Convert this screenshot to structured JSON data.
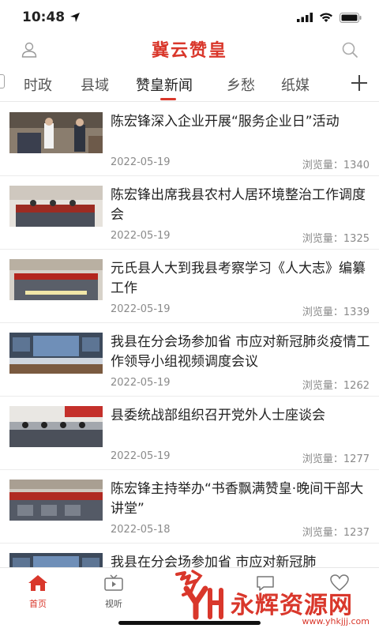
{
  "status": {
    "time": "10:48"
  },
  "header": {
    "title": "冀云赞皇"
  },
  "tabs": [
    {
      "label": "时政"
    },
    {
      "label": "县域"
    },
    {
      "label": "赞皇新闻"
    },
    {
      "label": "乡愁"
    },
    {
      "label": "纸媒"
    }
  ],
  "views_label": "浏览量：",
  "news": [
    {
      "title": "陈宏锋深入企业开展“服务企业日”活动",
      "date": "2022-05-19",
      "views": "浏览量：1340"
    },
    {
      "title": "陈宏锋出席我县农村人居环境整治工作调度会",
      "date": "2022-05-19",
      "views": "浏览量：1325"
    },
    {
      "title": "元氏县人大到我县考察学习《人大志》编纂工作",
      "date": "2022-05-19",
      "views": "浏览量：1339"
    },
    {
      "title": "我县在分会场参加省 市应对新冠肺炎疫情工作领导小组视频调度会议",
      "date": "2022-05-19",
      "views": "浏览量：1262"
    },
    {
      "title": "县委统战部组织召开党外人士座谈会",
      "date": "2022-05-19",
      "views": "浏览量：1277"
    },
    {
      "title": "陈宏锋主持举办“书香飘满赞皇·晚间干部大讲堂”",
      "date": "2022-05-18",
      "views": "浏览量：1237"
    },
    {
      "title": "我县在分会场参加省 市应对新冠肺",
      "date": "",
      "views": ""
    }
  ],
  "tabbar": [
    {
      "label": "首页",
      "icon": "home-icon"
    },
    {
      "label": "视听",
      "icon": "tv-icon"
    },
    {
      "label": "",
      "icon": "zan-logo-icon"
    },
    {
      "label": "",
      "icon": "chat-icon"
    },
    {
      "label": "",
      "icon": "heart-icon"
    }
  ],
  "watermark": {
    "text": "永辉资源网",
    "url": "www.yhkjjj.com"
  },
  "colors": {
    "accent": "#d9372b"
  }
}
